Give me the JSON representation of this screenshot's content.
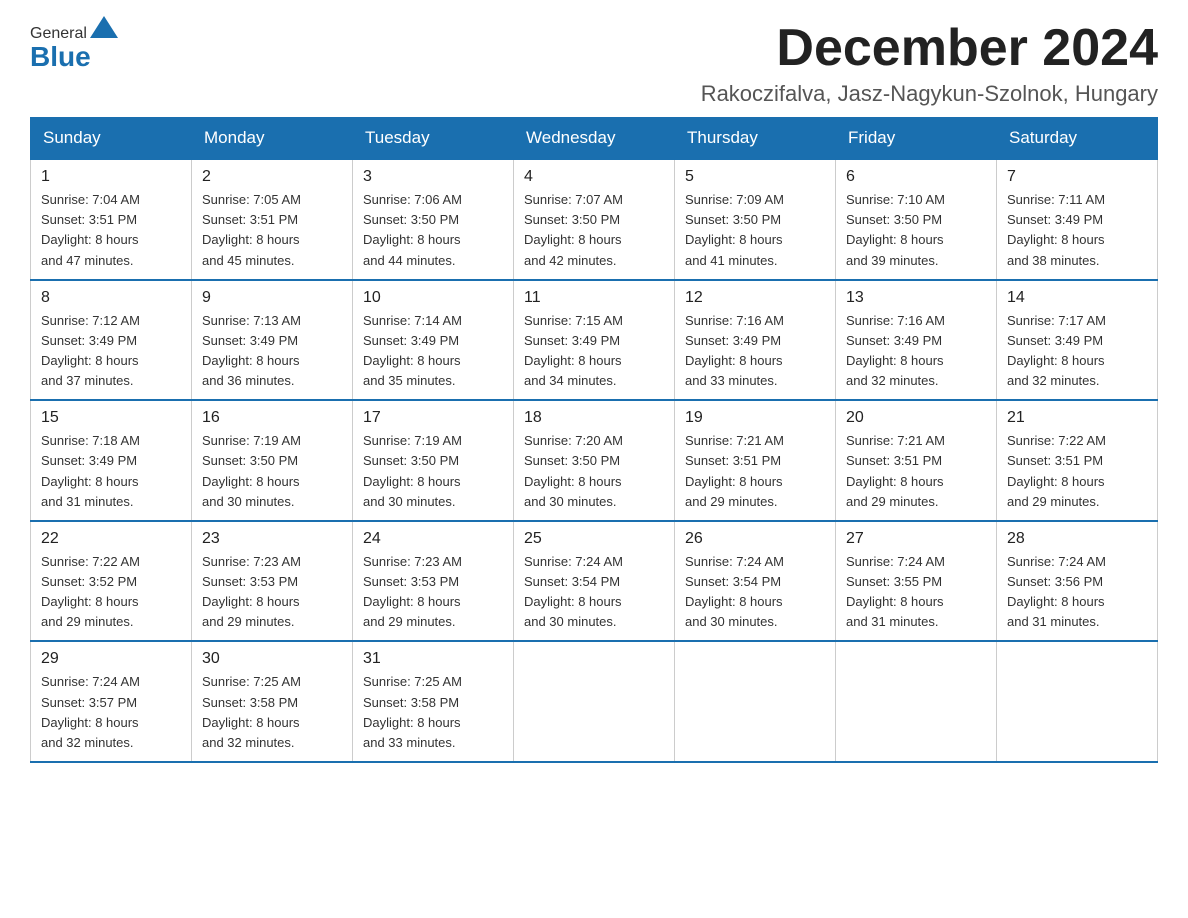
{
  "header": {
    "logo_general": "General",
    "logo_blue": "Blue",
    "month_title": "December 2024",
    "location": "Rakoczifalva, Jasz-Nagykun-Szolnok, Hungary"
  },
  "weekdays": [
    "Sunday",
    "Monday",
    "Tuesday",
    "Wednesday",
    "Thursday",
    "Friday",
    "Saturday"
  ],
  "weeks": [
    [
      {
        "day": "1",
        "sunrise": "7:04 AM",
        "sunset": "3:51 PM",
        "daylight": "8 hours and 47 minutes."
      },
      {
        "day": "2",
        "sunrise": "7:05 AM",
        "sunset": "3:51 PM",
        "daylight": "8 hours and 45 minutes."
      },
      {
        "day": "3",
        "sunrise": "7:06 AM",
        "sunset": "3:50 PM",
        "daylight": "8 hours and 44 minutes."
      },
      {
        "day": "4",
        "sunrise": "7:07 AM",
        "sunset": "3:50 PM",
        "daylight": "8 hours and 42 minutes."
      },
      {
        "day": "5",
        "sunrise": "7:09 AM",
        "sunset": "3:50 PM",
        "daylight": "8 hours and 41 minutes."
      },
      {
        "day": "6",
        "sunrise": "7:10 AM",
        "sunset": "3:50 PM",
        "daylight": "8 hours and 39 minutes."
      },
      {
        "day": "7",
        "sunrise": "7:11 AM",
        "sunset": "3:49 PM",
        "daylight": "8 hours and 38 minutes."
      }
    ],
    [
      {
        "day": "8",
        "sunrise": "7:12 AM",
        "sunset": "3:49 PM",
        "daylight": "8 hours and 37 minutes."
      },
      {
        "day": "9",
        "sunrise": "7:13 AM",
        "sunset": "3:49 PM",
        "daylight": "8 hours and 36 minutes."
      },
      {
        "day": "10",
        "sunrise": "7:14 AM",
        "sunset": "3:49 PM",
        "daylight": "8 hours and 35 minutes."
      },
      {
        "day": "11",
        "sunrise": "7:15 AM",
        "sunset": "3:49 PM",
        "daylight": "8 hours and 34 minutes."
      },
      {
        "day": "12",
        "sunrise": "7:16 AM",
        "sunset": "3:49 PM",
        "daylight": "8 hours and 33 minutes."
      },
      {
        "day": "13",
        "sunrise": "7:16 AM",
        "sunset": "3:49 PM",
        "daylight": "8 hours and 32 minutes."
      },
      {
        "day": "14",
        "sunrise": "7:17 AM",
        "sunset": "3:49 PM",
        "daylight": "8 hours and 32 minutes."
      }
    ],
    [
      {
        "day": "15",
        "sunrise": "7:18 AM",
        "sunset": "3:49 PM",
        "daylight": "8 hours and 31 minutes."
      },
      {
        "day": "16",
        "sunrise": "7:19 AM",
        "sunset": "3:50 PM",
        "daylight": "8 hours and 30 minutes."
      },
      {
        "day": "17",
        "sunrise": "7:19 AM",
        "sunset": "3:50 PM",
        "daylight": "8 hours and 30 minutes."
      },
      {
        "day": "18",
        "sunrise": "7:20 AM",
        "sunset": "3:50 PM",
        "daylight": "8 hours and 30 minutes."
      },
      {
        "day": "19",
        "sunrise": "7:21 AM",
        "sunset": "3:51 PM",
        "daylight": "8 hours and 29 minutes."
      },
      {
        "day": "20",
        "sunrise": "7:21 AM",
        "sunset": "3:51 PM",
        "daylight": "8 hours and 29 minutes."
      },
      {
        "day": "21",
        "sunrise": "7:22 AM",
        "sunset": "3:51 PM",
        "daylight": "8 hours and 29 minutes."
      }
    ],
    [
      {
        "day": "22",
        "sunrise": "7:22 AM",
        "sunset": "3:52 PM",
        "daylight": "8 hours and 29 minutes."
      },
      {
        "day": "23",
        "sunrise": "7:23 AM",
        "sunset": "3:53 PM",
        "daylight": "8 hours and 29 minutes."
      },
      {
        "day": "24",
        "sunrise": "7:23 AM",
        "sunset": "3:53 PM",
        "daylight": "8 hours and 29 minutes."
      },
      {
        "day": "25",
        "sunrise": "7:24 AM",
        "sunset": "3:54 PM",
        "daylight": "8 hours and 30 minutes."
      },
      {
        "day": "26",
        "sunrise": "7:24 AM",
        "sunset": "3:54 PM",
        "daylight": "8 hours and 30 minutes."
      },
      {
        "day": "27",
        "sunrise": "7:24 AM",
        "sunset": "3:55 PM",
        "daylight": "8 hours and 31 minutes."
      },
      {
        "day": "28",
        "sunrise": "7:24 AM",
        "sunset": "3:56 PM",
        "daylight": "8 hours and 31 minutes."
      }
    ],
    [
      {
        "day": "29",
        "sunrise": "7:24 AM",
        "sunset": "3:57 PM",
        "daylight": "8 hours and 32 minutes."
      },
      {
        "day": "30",
        "sunrise": "7:25 AM",
        "sunset": "3:58 PM",
        "daylight": "8 hours and 32 minutes."
      },
      {
        "day": "31",
        "sunrise": "7:25 AM",
        "sunset": "3:58 PM",
        "daylight": "8 hours and 33 minutes."
      },
      null,
      null,
      null,
      null
    ]
  ]
}
